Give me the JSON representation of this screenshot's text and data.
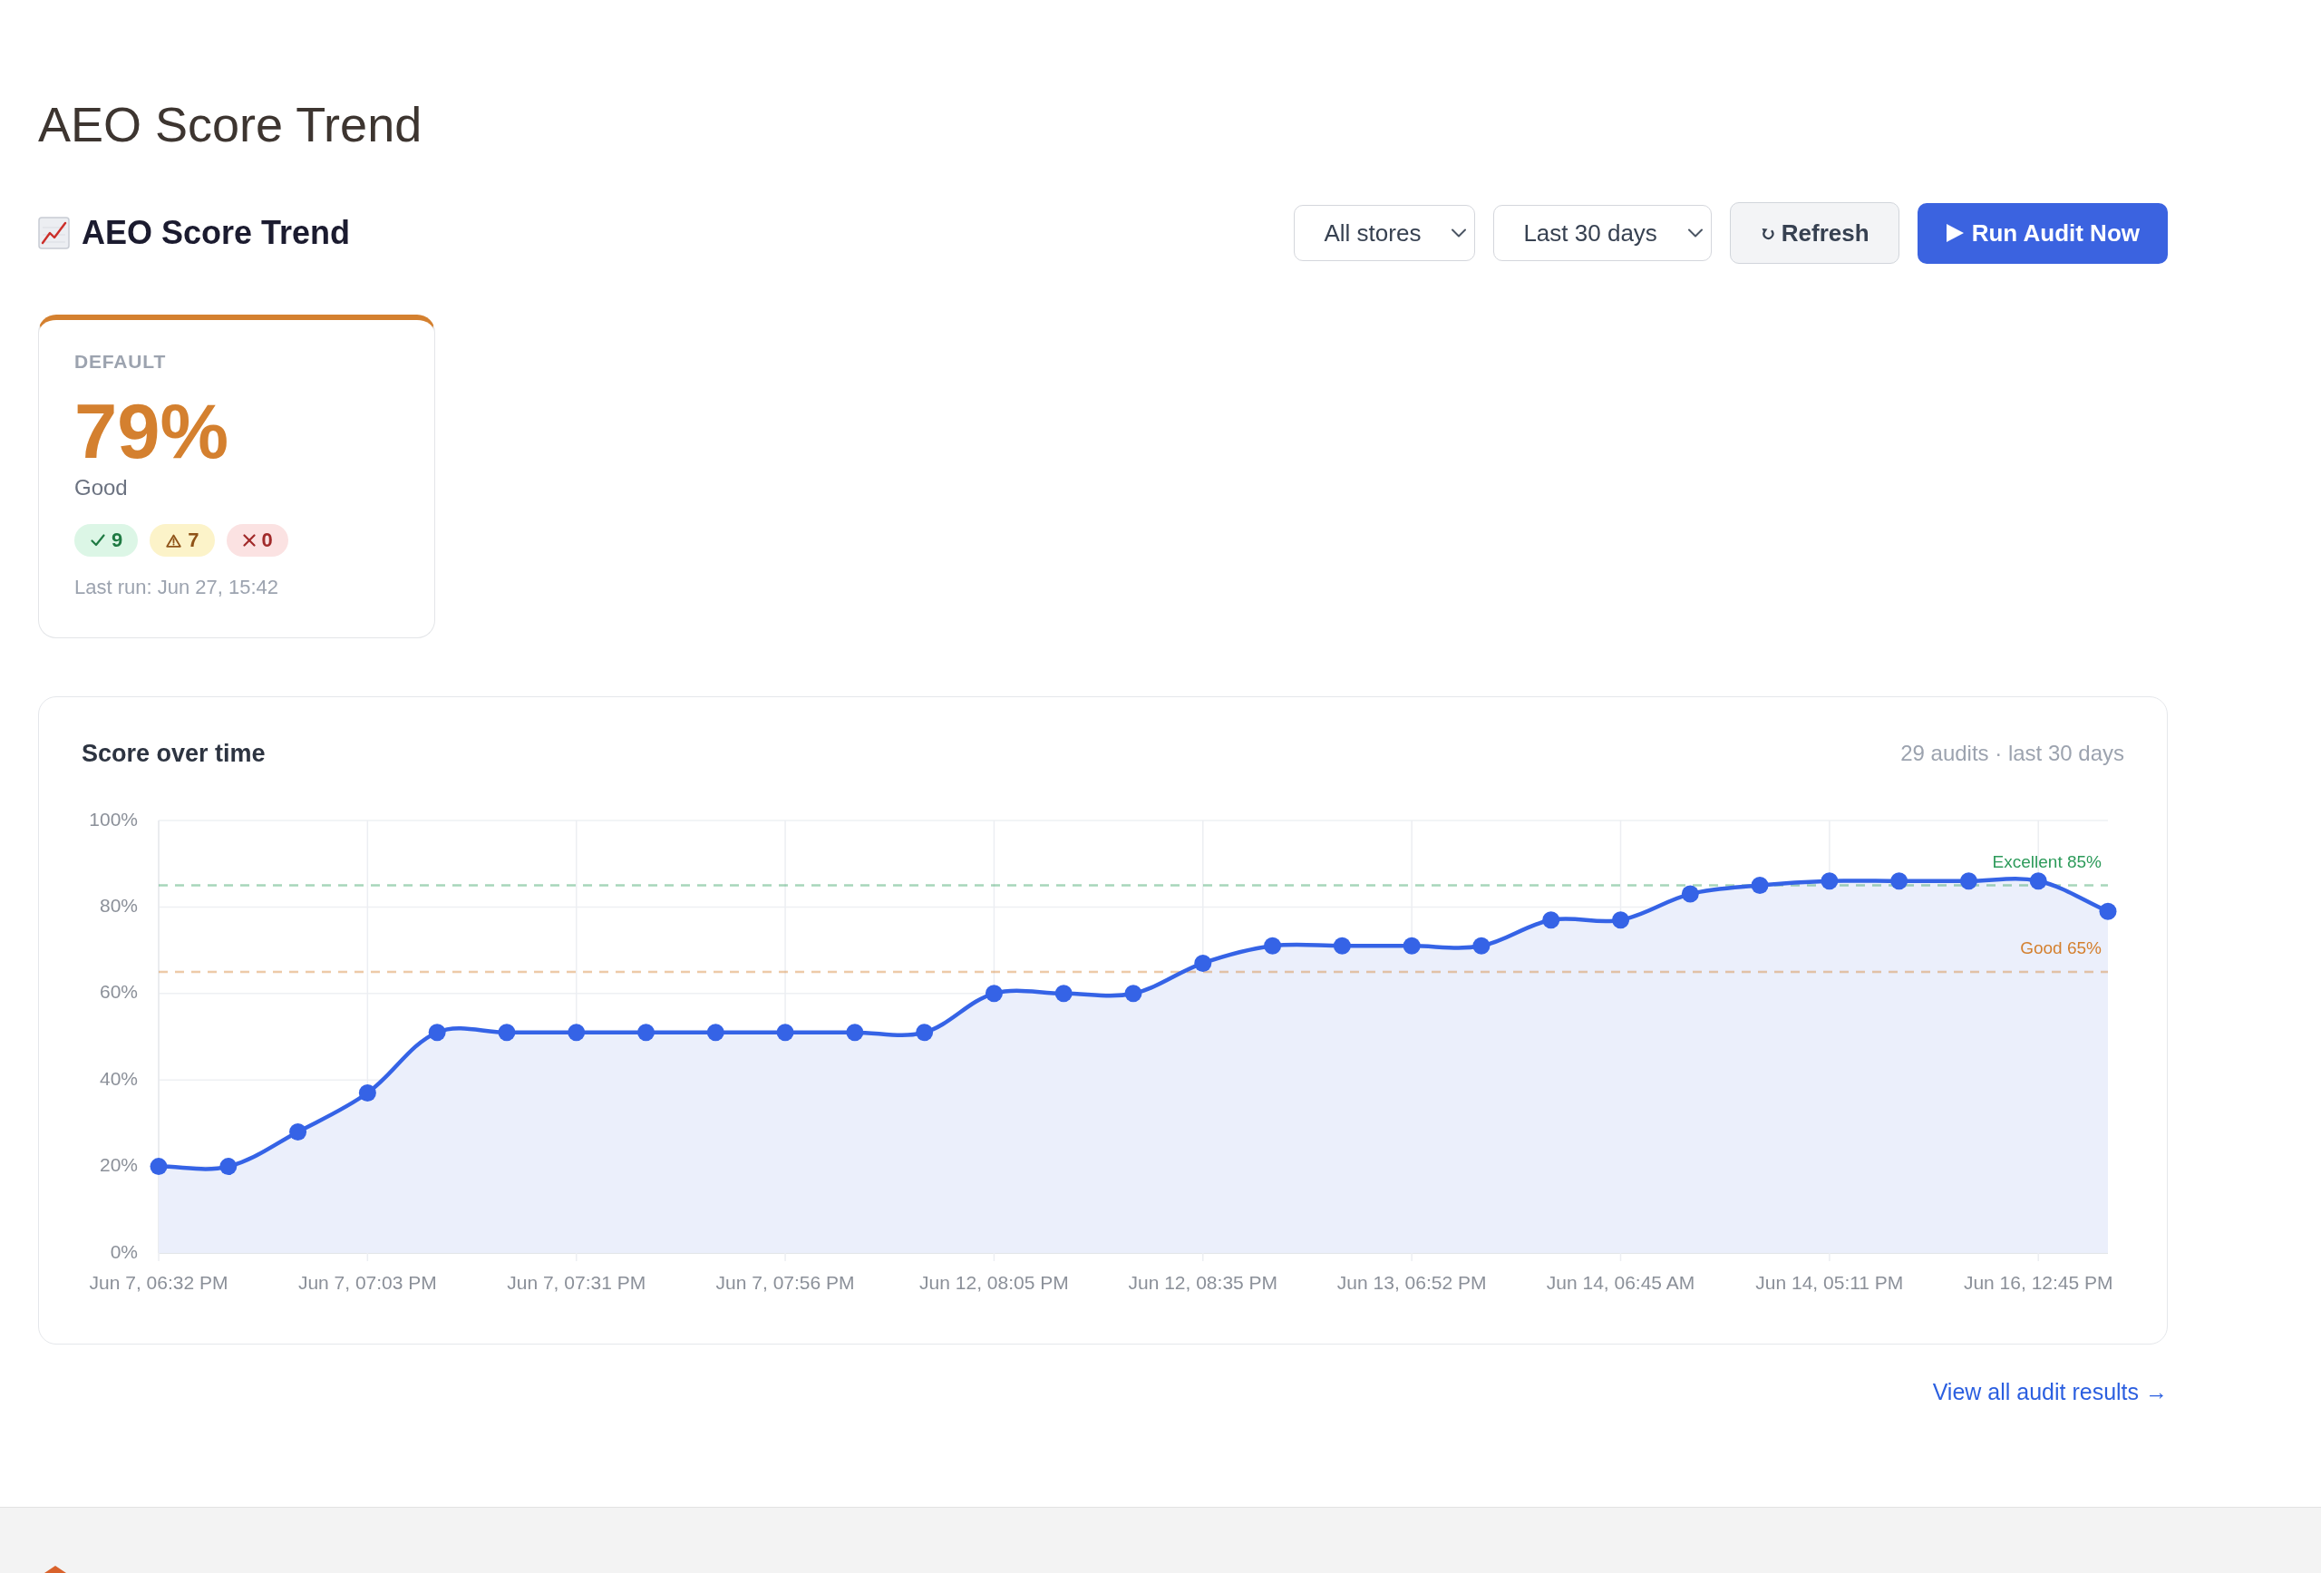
{
  "page_title": "AEO Score Trend",
  "toolbar": {
    "title": "AEO Score Trend",
    "dropdowns": [
      {
        "value": "All stores"
      },
      {
        "value": "Last 30 days"
      }
    ],
    "buttons": [
      {
        "kind": "refresh",
        "label": "Refresh"
      },
      {
        "kind": "run",
        "label": "Run Audit Now"
      }
    ]
  },
  "score_cards": [
    {
      "store": "DEFAULT",
      "score": "79%",
      "rating": "Good",
      "color": "#d4802f",
      "counts": [
        {
          "kind": "pass",
          "value": "9"
        },
        {
          "kind": "warning",
          "value": "7"
        },
        {
          "kind": "fail",
          "value": "0"
        }
      ],
      "last_run": "Last run: Jun 27, 15:42"
    }
  ],
  "trend_panel": {
    "summary": "29 audits · last 30 days",
    "chart_data": {
      "type": "area",
      "title": "Score over time",
      "categories": [
        "Jun 7, 06:32 PM",
        null,
        null,
        "Jun 7, 07:03 PM",
        null,
        null,
        "Jun 7, 07:31 PM",
        null,
        null,
        "Jun 7, 07:56 PM",
        null,
        null,
        "Jun 12, 08:05 PM",
        null,
        null,
        "Jun 12, 08:35 PM",
        null,
        null,
        "Jun 13, 06:52 PM",
        null,
        null,
        "Jun 14, 06:45 AM",
        null,
        null,
        "Jun 14, 05:11 PM",
        null,
        null,
        "Jun 16, 12:45 PM",
        null
      ],
      "values": [
        20,
        20,
        28,
        37,
        51,
        51,
        51,
        51,
        51,
        51,
        51,
        51,
        60,
        60,
        60,
        67,
        71,
        71,
        71,
        71,
        77,
        77,
        83,
        85,
        86,
        86,
        86,
        86,
        79
      ],
      "ylim": [
        0,
        100
      ],
      "yticks": [
        {
          "value": 0,
          "label": "0%"
        },
        {
          "value": 20,
          "label": "20%"
        },
        {
          "value": 40,
          "label": "40%"
        },
        {
          "value": 60,
          "label": "60%"
        },
        {
          "value": 80,
          "label": "80%"
        },
        {
          "value": 100,
          "label": "100%"
        }
      ],
      "grid": true,
      "ref_lines": [
        {
          "axis": "y",
          "value": 85,
          "label": "Excellent 85%",
          "color": "#2e9b5b"
        },
        {
          "axis": "y",
          "value": 65,
          "label": "Good 65%",
          "color": "#d4802f"
        }
      ]
    }
  },
  "view_all_link": "View all audit results →"
}
